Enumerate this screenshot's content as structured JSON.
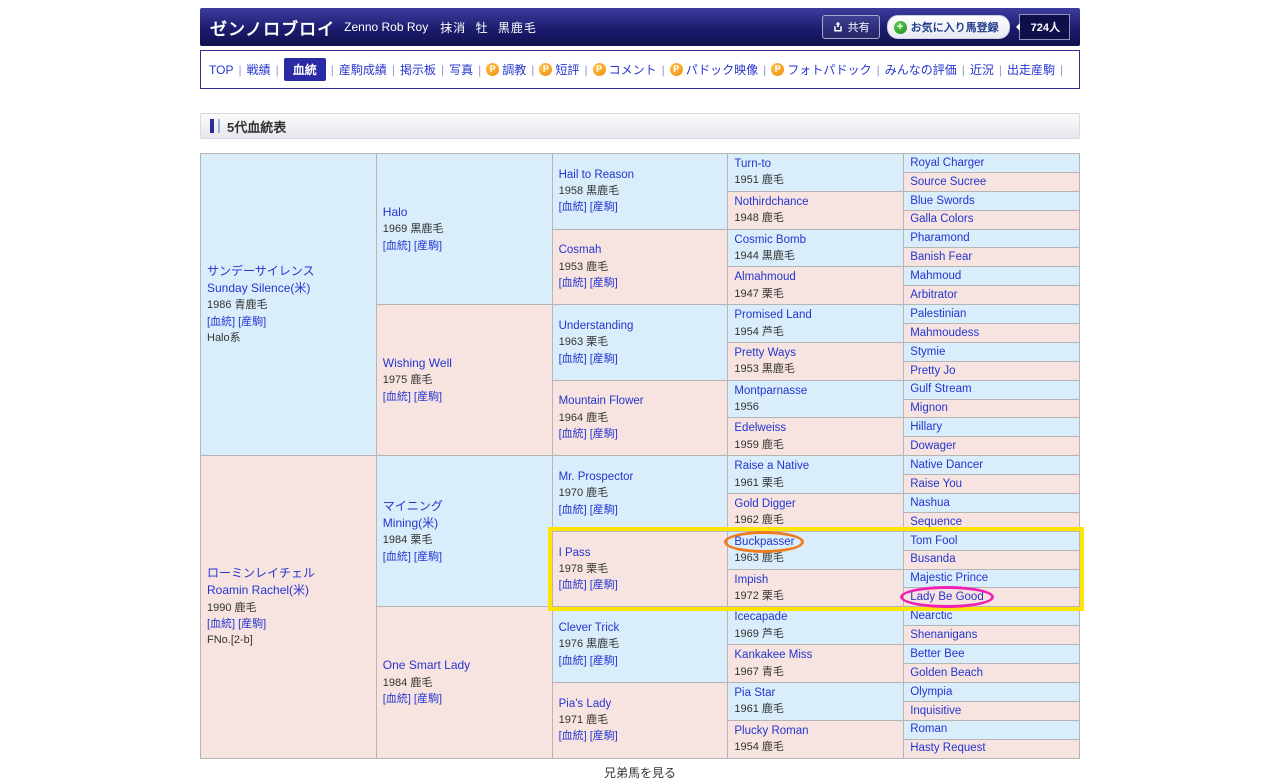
{
  "colors": {
    "male_cell": "#d9edfb",
    "female_cell": "#f7e4e0",
    "link_blue": "#2535cf",
    "header_navy": "#1c1c6e",
    "nav_active": "#2a2aa4",
    "highlight_yellow": "#ffe400",
    "circle_orange": "#ef7d1f",
    "circle_magenta": "#ee22b5"
  },
  "header": {
    "title": "ゼンノロブロイ",
    "name_en": "Zenno Rob Roy",
    "status": "抹消",
    "sex": "牡",
    "coat": "黒鹿毛",
    "share": "共有",
    "favorite": "お気に入り馬登録",
    "fans": "724人"
  },
  "nav": {
    "separator": "|",
    "premium_glyph": "P",
    "items": [
      {
        "key": "top",
        "label": "TOP"
      },
      {
        "key": "results",
        "label": "戦績"
      },
      {
        "key": "pedigree",
        "label": "血統",
        "active": true
      },
      {
        "key": "offspring-results",
        "label": "産駒成績"
      },
      {
        "key": "board",
        "label": "掲示板"
      },
      {
        "key": "photos",
        "label": "写真"
      },
      {
        "key": "training",
        "label": "調教",
        "premium": true
      },
      {
        "key": "short-review",
        "label": "短評",
        "premium": true
      },
      {
        "key": "comments",
        "label": "コメント",
        "premium": true
      },
      {
        "key": "paddock-video",
        "label": "パドック映像",
        "premium": true
      },
      {
        "key": "photo-paddock",
        "label": "フォトパドック",
        "premium": true
      },
      {
        "key": "everyone-rating",
        "label": "みんなの評価"
      },
      {
        "key": "recent",
        "label": "近況"
      },
      {
        "key": "running-offspring",
        "label": "出走産駒"
      }
    ]
  },
  "section_title": "5代血統表",
  "bottom_note": "兄弟馬を見る",
  "pedigree": {
    "blood_link": "[血統]",
    "offspring_link": "[産駒]",
    "gen1": [
      {
        "name": "サンデーサイレンス",
        "name2": "Sunday Silence(米)",
        "info": "1986 青鹿毛",
        "extra": "Halo系"
      },
      {
        "name": "ローミンレイチェル",
        "name2": "Roamin Rachel(米)",
        "info": "1990 鹿毛",
        "extra": "FNo.[2-b]"
      }
    ],
    "gen2": [
      {
        "name": "Halo",
        "info": "1969 黒鹿毛"
      },
      {
        "name": "Wishing Well",
        "info": "1975 鹿毛"
      },
      {
        "name": "マイニング",
        "name2": "Mining(米)",
        "info": "1984 栗毛"
      },
      {
        "name": "One Smart Lady",
        "info": "1984 鹿毛"
      }
    ],
    "gen3": [
      {
        "name": "Hail to Reason",
        "info": "1958 黒鹿毛"
      },
      {
        "name": "Cosmah",
        "info": "1953 鹿毛"
      },
      {
        "name": "Understanding",
        "info": "1963 栗毛"
      },
      {
        "name": "Mountain Flower",
        "info": "1964 鹿毛"
      },
      {
        "name": "Mr. Prospector",
        "info": "1970 鹿毛"
      },
      {
        "name": "I Pass",
        "info": "1978 栗毛",
        "hl": "start"
      },
      {
        "name": "Clever Trick",
        "info": "1976 黒鹿毛"
      },
      {
        "name": "Pia's Lady",
        "info": "1971 鹿毛"
      }
    ],
    "gen4": [
      {
        "name": "Turn-to",
        "info": "1951 鹿毛"
      },
      {
        "name": "Nothirdchance",
        "info": "1948 鹿毛"
      },
      {
        "name": "Cosmic Bomb",
        "info": "1944 黒鹿毛"
      },
      {
        "name": "Almahmoud",
        "info": "1947 栗毛"
      },
      {
        "name": "Promised Land",
        "info": "1954 芦毛"
      },
      {
        "name": "Pretty Ways",
        "info": "1953 黒鹿毛"
      },
      {
        "name": "Montparnasse",
        "info": "1956"
      },
      {
        "name": "Edelweiss",
        "info": "1959 鹿毛"
      },
      {
        "name": "Raise a Native",
        "info": "1961 栗毛"
      },
      {
        "name": "Gold Digger",
        "info": "1962 鹿毛"
      },
      {
        "name": "Buckpasser",
        "info": "1963 鹿毛",
        "circle": "orange"
      },
      {
        "name": "Impish",
        "info": "1972 栗毛"
      },
      {
        "name": "Icecapade",
        "info": "1969 芦毛"
      },
      {
        "name": "Kankakee Miss",
        "info": "1967 青毛"
      },
      {
        "name": "Pia Star",
        "info": "1961 鹿毛"
      },
      {
        "name": "Plucky Roman",
        "info": "1954 鹿毛"
      }
    ],
    "gen5": [
      {
        "name": "Royal Charger"
      },
      {
        "name": "Source Sucree"
      },
      {
        "name": "Blue Swords"
      },
      {
        "name": "Galla Colors"
      },
      {
        "name": "Pharamond"
      },
      {
        "name": "Banish Fear"
      },
      {
        "name": "Mahmoud"
      },
      {
        "name": "Arbitrator"
      },
      {
        "name": "Palestinian"
      },
      {
        "name": "Mahmoudess"
      },
      {
        "name": "Stymie"
      },
      {
        "name": "Pretty Jo"
      },
      {
        "name": "Gulf Stream"
      },
      {
        "name": "Mignon"
      },
      {
        "name": "Hillary"
      },
      {
        "name": "Dowager"
      },
      {
        "name": "Native Dancer"
      },
      {
        "name": "Raise You"
      },
      {
        "name": "Nashua"
      },
      {
        "name": "Sequence"
      },
      {
        "name": "Tom Fool"
      },
      {
        "name": "Busanda"
      },
      {
        "name": "Majestic Prince"
      },
      {
        "name": "Lady Be Good",
        "circle": "magenta",
        "hl": "end"
      },
      {
        "name": "Nearctic"
      },
      {
        "name": "Shenanigans"
      },
      {
        "name": "Better Bee"
      },
      {
        "name": "Golden Beach"
      },
      {
        "name": "Olympia"
      },
      {
        "name": "Inquisitive"
      },
      {
        "name": "Roman"
      },
      {
        "name": "Hasty Request"
      }
    ]
  }
}
